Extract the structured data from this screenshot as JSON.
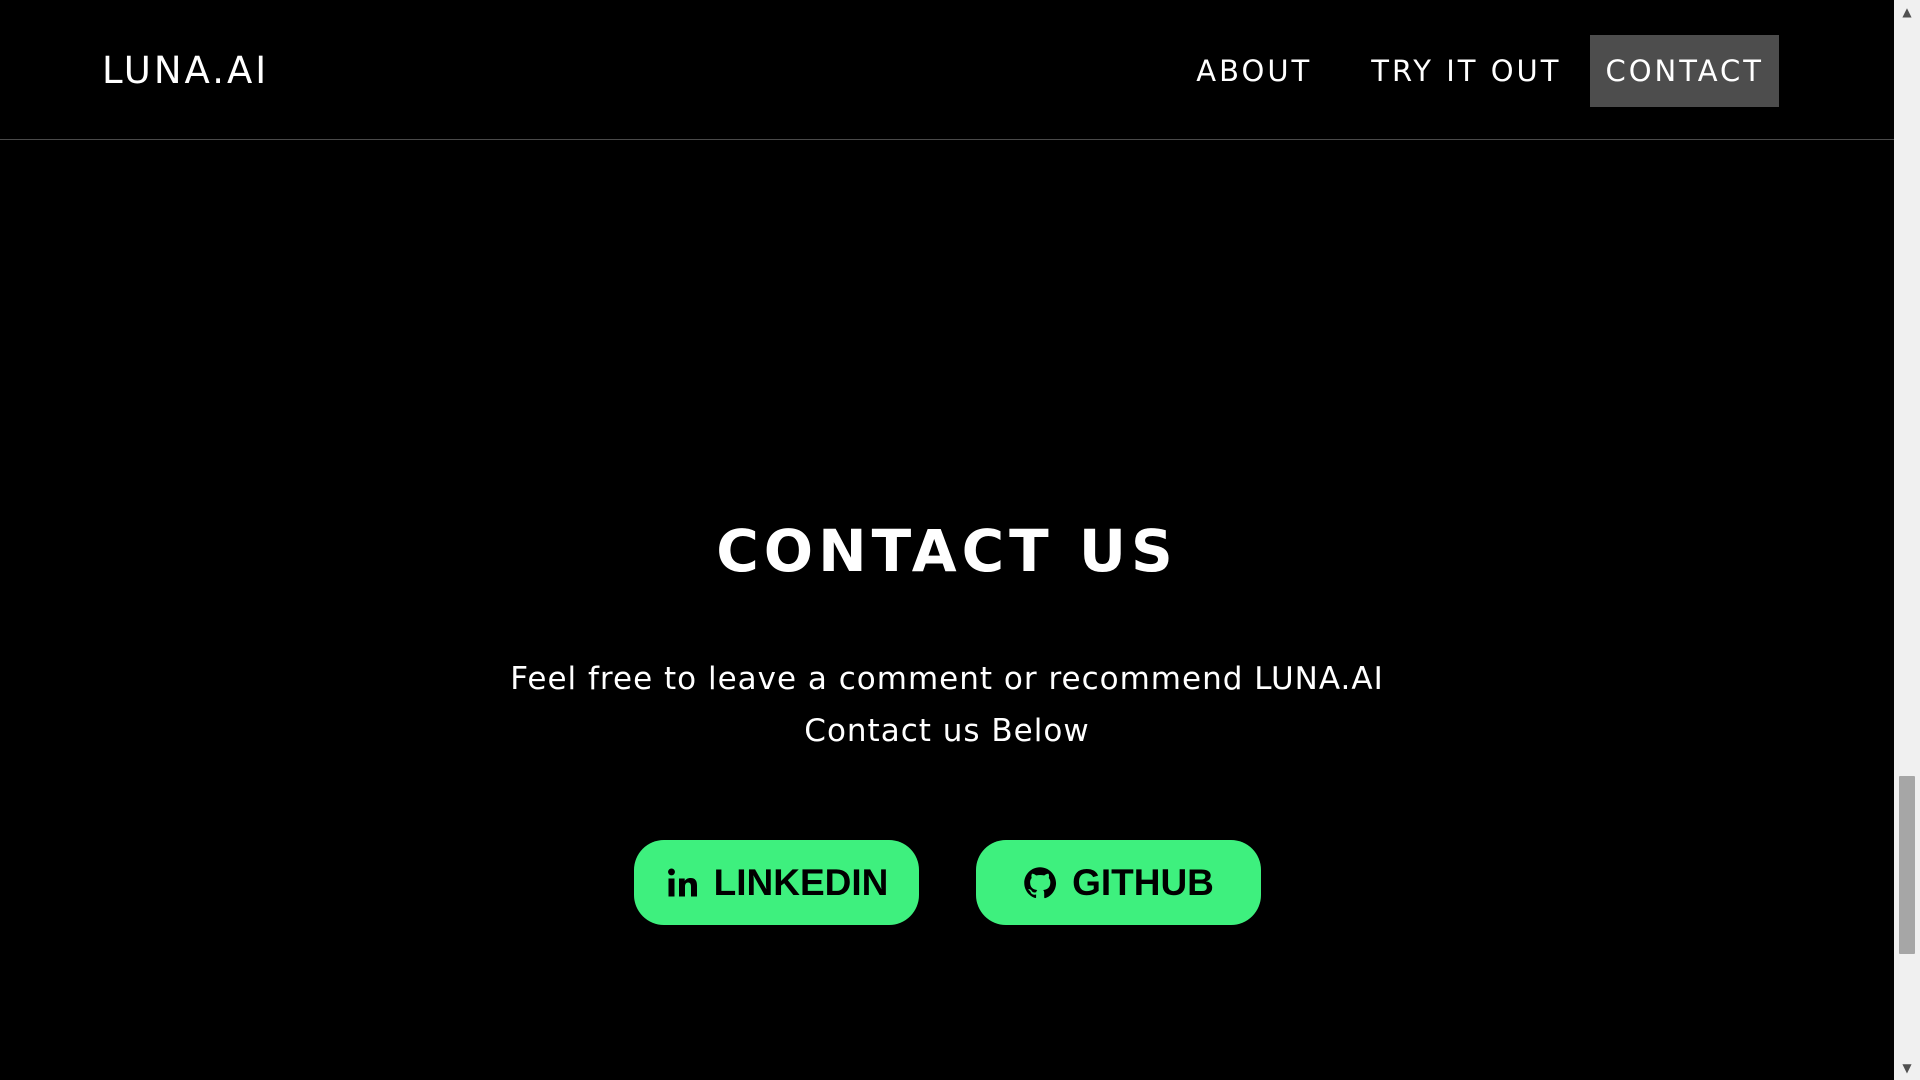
{
  "navbar": {
    "brand": "LUNA.AI",
    "links": [
      {
        "label": "ABOUT",
        "active": false
      },
      {
        "label": "TRY IT OUT",
        "active": false
      },
      {
        "label": "CONTACT",
        "active": true
      }
    ]
  },
  "contact": {
    "title": "CONTACT US",
    "line1": "Feel free to leave a comment or recommend LUNA.AI",
    "line2": "Contact us Below",
    "buttons": [
      {
        "label": "LINKEDIN",
        "icon": "linkedin-icon"
      },
      {
        "label": "GITHUB",
        "icon": "github-icon"
      }
    ]
  },
  "colors": {
    "background": "#000000",
    "accent": "#3ef07e",
    "nav_active_bg": "#4d4d4d",
    "text": "#ffffff"
  }
}
